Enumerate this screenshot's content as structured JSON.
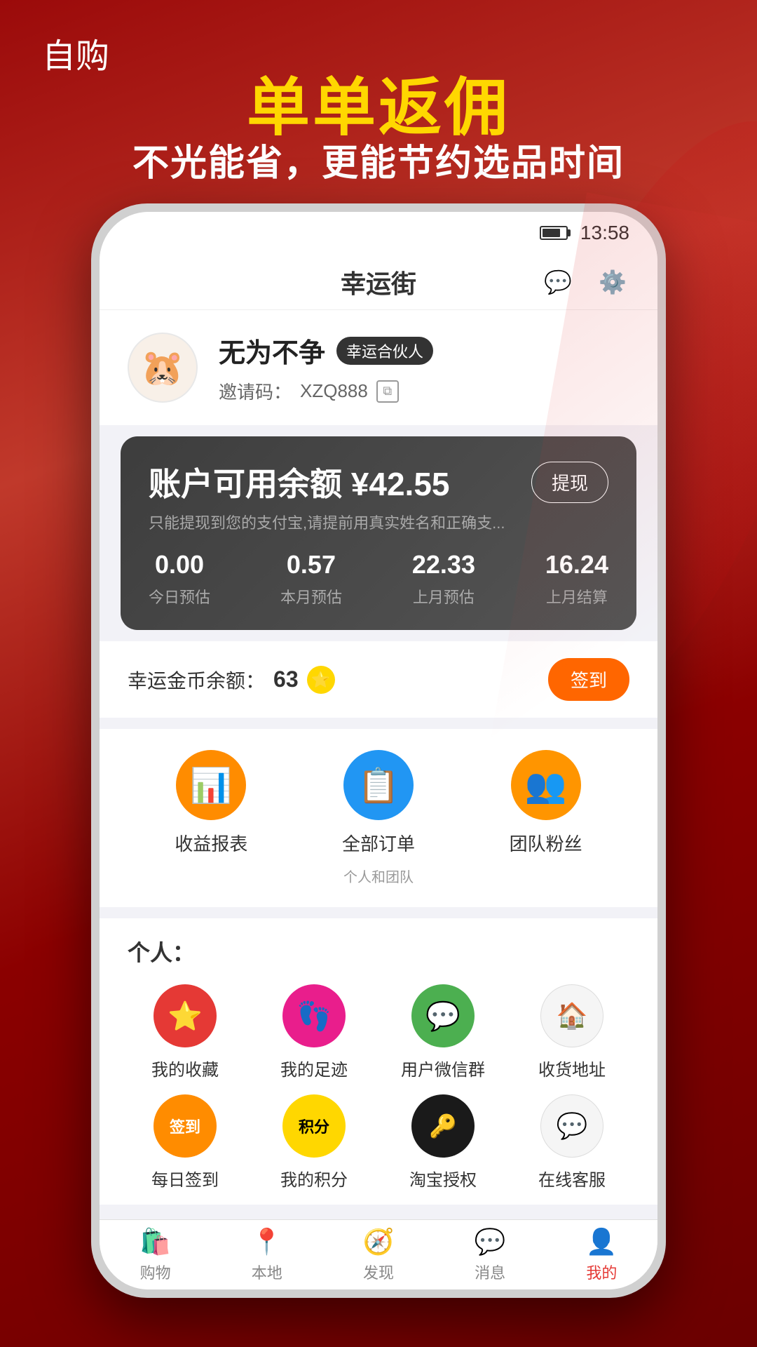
{
  "page": {
    "background_label": "自购",
    "main_title": "单单返佣",
    "sub_title": "不光能省，更能节约选品时间"
  },
  "status_bar": {
    "time": "13:58"
  },
  "top_nav": {
    "title": "幸运街",
    "message_icon": "💬",
    "settings_icon": "⚙️"
  },
  "profile": {
    "avatar_emoji": "🐹",
    "name": "无为不争",
    "badge": "幸运合伙人",
    "invite_label": "邀请码：",
    "invite_code": "XZQ888"
  },
  "balance_card": {
    "title": "账户可用余额 ¥",
    "amount": "42.55",
    "note": "只能提现到您的支付宝,请提前用真实姓名和正确支...",
    "withdraw_label": "提现",
    "stats": [
      {
        "value": "0.00",
        "label": "今日预估"
      },
      {
        "value": "0.57",
        "label": "本月预估"
      },
      {
        "value": "22.33",
        "label": "上月预估"
      },
      {
        "value": "16.24",
        "label": "上月结算"
      }
    ]
  },
  "coin_section": {
    "label": "幸运金币余额：",
    "count": "63",
    "checkin_label": "签到"
  },
  "features": [
    {
      "icon": "📊",
      "label": "收益报表",
      "sublabel": "",
      "bg": "orange"
    },
    {
      "icon": "📋",
      "label": "全部订单",
      "sublabel": "个人和团队",
      "bg": "blue"
    },
    {
      "icon": "👥",
      "label": "团队粉丝",
      "sublabel": "",
      "bg": "orange-light"
    }
  ],
  "personal_section": {
    "title": "个人：",
    "icons": [
      {
        "icon": "⭐",
        "label": "我的收藏",
        "bg": "red"
      },
      {
        "icon": "👣",
        "label": "我的足迹",
        "bg": "pink"
      },
      {
        "icon": "💬",
        "label": "用户微信群",
        "bg": "green"
      },
      {
        "icon": "🏠",
        "label": "收货地址",
        "bg": "house"
      },
      {
        "icon": "签到",
        "label": "每日签到",
        "bg": "orange-sign"
      },
      {
        "icon": "积分",
        "label": "我的积分",
        "bg": "score"
      },
      {
        "icon": "🔑",
        "label": "淘宝授权",
        "bg": "black"
      },
      {
        "icon": "💬",
        "label": "在线客服",
        "bg": "chat"
      }
    ]
  },
  "bottom_nav": {
    "items": [
      {
        "icon": "🛍️",
        "label": "购物",
        "active": false
      },
      {
        "icon": "📍",
        "label": "本地",
        "active": false
      },
      {
        "icon": "🧭",
        "label": "发现",
        "active": false
      },
      {
        "icon": "💬",
        "label": "消息",
        "active": false
      },
      {
        "icon": "👤",
        "label": "我的",
        "active": true
      }
    ]
  }
}
